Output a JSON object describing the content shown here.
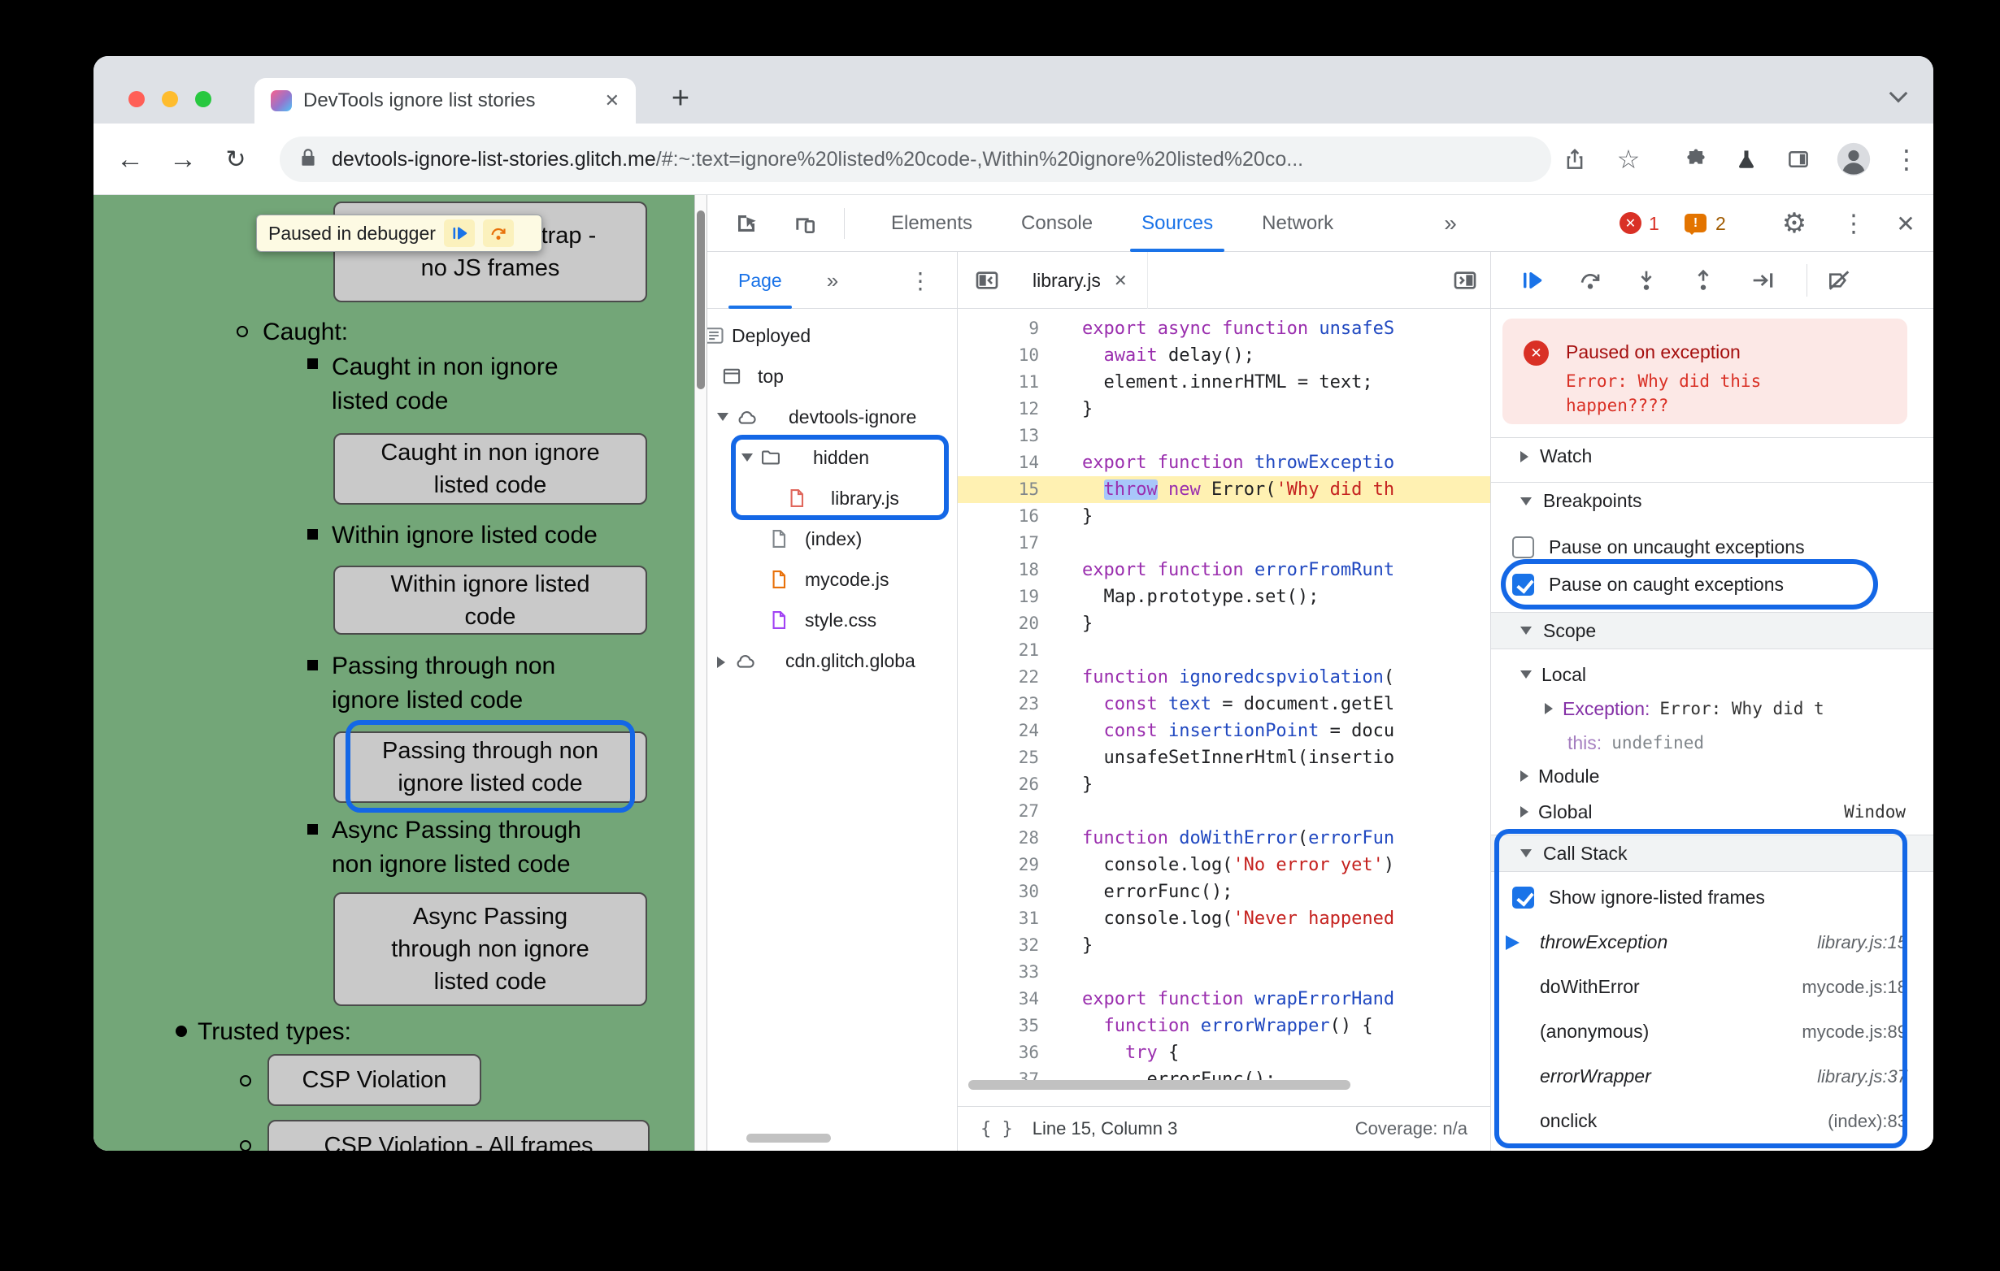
{
  "icons": {
    "back": "←",
    "forward": "→",
    "reload": "↻",
    "star": "☆",
    "kebab": "⋮",
    "more": "»",
    "close": "✕",
    "gear": "⚙",
    "new_tab": "+",
    "braces": "{ }",
    "bang": "!",
    "error_x": "✕"
  },
  "browser": {
    "tab_title": "DevTools ignore list stories",
    "url_domain": "devtools-ignore-list-stories.glitch.me",
    "url_path": "/#:~:text=ignore%20listed%20code-,Within%20ignore%20listed%20co..."
  },
  "page": {
    "paused_banner": "Paused in debugger",
    "list": [
      {
        "bullet": "square",
        "button_lines": [
          "WebAssembly trap -",
          "no JS frames"
        ]
      },
      {
        "bullet": "circle",
        "label_lines": [
          "Caught:"
        ]
      },
      {
        "bullet": "square",
        "label_lines": [
          "Caught in non ignore",
          "listed code"
        ],
        "button_lines": [
          "Caught in non ignore",
          "listed code"
        ]
      },
      {
        "bullet": "square",
        "label_lines": [
          "Within ignore listed code"
        ],
        "button_lines": [
          "Within ignore listed",
          "code"
        ]
      },
      {
        "bullet": "square",
        "label_lines": [
          "Passing through non",
          "ignore listed code"
        ],
        "button_lines": [
          "Passing through non",
          "ignore listed code"
        ],
        "highlighted": true
      },
      {
        "bullet": "square",
        "label_lines": [
          "Async Passing through",
          "non ignore listed code"
        ],
        "button_lines": [
          "Async Passing",
          "through non ignore",
          "listed code"
        ]
      },
      {
        "bullet": "disc",
        "label_lines": [
          "Trusted types:"
        ]
      },
      {
        "bullet": "circle",
        "button_lines": [
          "CSP Violation"
        ]
      },
      {
        "bullet": "circle",
        "button_lines": [
          "CSP Violation - All frames"
        ]
      }
    ]
  },
  "devtools": {
    "main_tabs": [
      {
        "label": "Elements",
        "active": false
      },
      {
        "label": "Console",
        "active": false
      },
      {
        "label": "Sources",
        "active": true
      },
      {
        "label": "Network",
        "active": false
      }
    ],
    "error_count": "1",
    "issue_count": "2",
    "navigator": {
      "tab_label": "Page",
      "tree": [
        {
          "label": "Deployed",
          "icon": "deployed",
          "arrow": "none"
        },
        {
          "label": "top",
          "icon": "frame",
          "arrow": "none"
        },
        {
          "label": "devtools-ignore",
          "icon": "cloud",
          "arrow": "down"
        },
        {
          "label": "hidden",
          "icon": "folder",
          "arrow": "down"
        },
        {
          "label": "library.js",
          "icon": "file-red",
          "arrow": "none"
        },
        {
          "label": "(index)",
          "icon": "file-gray",
          "arrow": "none"
        },
        {
          "label": "mycode.js",
          "icon": "file-orange",
          "arrow": "none"
        },
        {
          "label": "style.css",
          "icon": "file-purple",
          "arrow": "none"
        },
        {
          "label": "cdn.glitch.globa",
          "icon": "cloud",
          "arrow": "right"
        }
      ]
    },
    "editor": {
      "file_tab": "library.js",
      "status_line": "Line 15, Column 3",
      "status_coverage": "Coverage: n/a",
      "lines": [
        {
          "n": 9,
          "seg": [
            [
              "k",
              "export async function"
            ],
            [
              "d",
              " "
            ],
            [
              "f",
              "unsafeS"
            ]
          ]
        },
        {
          "n": 10,
          "seg": [
            [
              "d",
              "  "
            ],
            [
              "k",
              "await"
            ],
            [
              "d",
              " delay();"
            ]
          ]
        },
        {
          "n": 11,
          "seg": [
            [
              "d",
              "  element.innerHTML = text;"
            ]
          ]
        },
        {
          "n": 12,
          "seg": [
            [
              "d",
              "}"
            ]
          ]
        },
        {
          "n": 13,
          "seg": []
        },
        {
          "n": 14,
          "seg": [
            [
              "k",
              "export function"
            ],
            [
              "d",
              " "
            ],
            [
              "f",
              "throwExceptio"
            ]
          ]
        },
        {
          "n": 15,
          "hl": true,
          "seg": [
            [
              "d",
              "  "
            ],
            [
              "ks",
              "throw"
            ],
            [
              "d",
              " "
            ],
            [
              "k",
              "new"
            ],
            [
              "d",
              " Error("
            ],
            [
              "s",
              "'Why did th"
            ]
          ]
        },
        {
          "n": 16,
          "seg": [
            [
              "d",
              "}"
            ]
          ]
        },
        {
          "n": 17,
          "seg": []
        },
        {
          "n": 18,
          "seg": [
            [
              "k",
              "export function"
            ],
            [
              "d",
              " "
            ],
            [
              "f",
              "errorFromRunt"
            ]
          ]
        },
        {
          "n": 19,
          "seg": [
            [
              "d",
              "  Map.prototype.set();"
            ]
          ]
        },
        {
          "n": 20,
          "seg": [
            [
              "d",
              "}"
            ]
          ]
        },
        {
          "n": 21,
          "seg": []
        },
        {
          "n": 22,
          "seg": [
            [
              "k",
              "function"
            ],
            [
              "d",
              " "
            ],
            [
              "f",
              "ignoredcspviolation"
            ],
            [
              "d",
              "("
            ]
          ]
        },
        {
          "n": 23,
          "seg": [
            [
              "d",
              "  "
            ],
            [
              "k",
              "const"
            ],
            [
              "d",
              " "
            ],
            [
              "f",
              "text"
            ],
            [
              "d",
              " = document.getEl"
            ]
          ]
        },
        {
          "n": 24,
          "seg": [
            [
              "d",
              "  "
            ],
            [
              "k",
              "const"
            ],
            [
              "d",
              " "
            ],
            [
              "f",
              "insertionPoint"
            ],
            [
              "d",
              " = docu"
            ]
          ]
        },
        {
          "n": 25,
          "seg": [
            [
              "d",
              "  unsafeSetInnerHtml(insertio"
            ]
          ]
        },
        {
          "n": 26,
          "seg": [
            [
              "d",
              "}"
            ]
          ]
        },
        {
          "n": 27,
          "seg": []
        },
        {
          "n": 28,
          "seg": [
            [
              "k",
              "function"
            ],
            [
              "d",
              " "
            ],
            [
              "f",
              "doWithError"
            ],
            [
              "d",
              "("
            ],
            [
              "f",
              "errorFun"
            ]
          ]
        },
        {
          "n": 29,
          "seg": [
            [
              "d",
              "  console.log("
            ],
            [
              "s",
              "'No error yet'"
            ],
            [
              "d",
              ")"
            ]
          ]
        },
        {
          "n": 30,
          "seg": [
            [
              "d",
              "  errorFunc();"
            ]
          ]
        },
        {
          "n": 31,
          "seg": [
            [
              "d",
              "  console.log("
            ],
            [
              "s",
              "'Never happened"
            ]
          ]
        },
        {
          "n": 32,
          "seg": [
            [
              "d",
              "}"
            ]
          ]
        },
        {
          "n": 33,
          "seg": []
        },
        {
          "n": 34,
          "seg": [
            [
              "k",
              "export function"
            ],
            [
              "d",
              " "
            ],
            [
              "f",
              "wrapErrorHand"
            ]
          ]
        },
        {
          "n": 35,
          "seg": [
            [
              "d",
              "  "
            ],
            [
              "k",
              "function"
            ],
            [
              "d",
              " "
            ],
            [
              "f",
              "errorWrapper"
            ],
            [
              "d",
              "() {"
            ]
          ]
        },
        {
          "n": 36,
          "seg": [
            [
              "d",
              "    "
            ],
            [
              "k",
              "try"
            ],
            [
              "d",
              " {"
            ]
          ]
        },
        {
          "n": 37,
          "seg": [
            [
              "d",
              "      errorFunc();"
            ]
          ]
        }
      ]
    },
    "debugger": {
      "paused_title": "Paused on exception",
      "paused_message": "Error: Why did this happen????",
      "sections": {
        "watch": "Watch",
        "breakpoints": "Breakpoints",
        "scope": "Scope",
        "callstack": "Call Stack"
      },
      "breakpoint_toggles": [
        {
          "label": "Pause on uncaught exceptions",
          "checked": false
        },
        {
          "label": "Pause on caught exceptions",
          "checked": true,
          "highlighted": true
        }
      ],
      "scope_rows": [
        {
          "kind": "group",
          "label": "Local"
        },
        {
          "kind": "var",
          "name": "Exception:",
          "value": "Error: Why did t"
        },
        {
          "kind": "var",
          "name": "this:",
          "value": "undefined",
          "muted": true
        },
        {
          "kind": "group",
          "label": "Module"
        },
        {
          "kind": "group",
          "label": "Global",
          "right": "Window"
        }
      ],
      "callstack_toggle": "Show ignore-listed frames",
      "frames": [
        {
          "name": "throwException",
          "loc": "library.js:15",
          "current": true,
          "ignore_listed": true
        },
        {
          "name": "doWithError",
          "loc": "mycode.js:18"
        },
        {
          "name": "(anonymous)",
          "loc": "mycode.js:89"
        },
        {
          "name": "errorWrapper",
          "loc": "library.js:37",
          "ignore_listed": true
        },
        {
          "name": "onclick",
          "loc": "(index):83"
        }
      ]
    }
  }
}
